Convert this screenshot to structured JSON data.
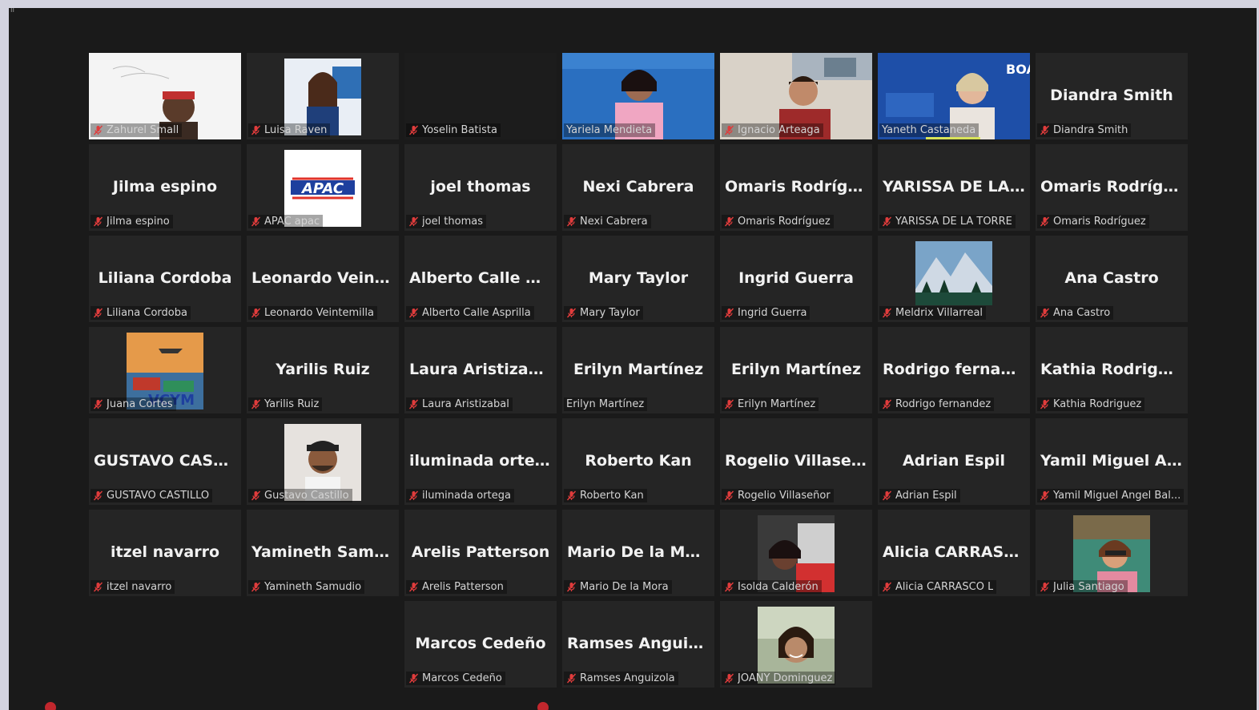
{
  "window": {
    "corner_mark": "ıı"
  },
  "colors": {
    "active_speaker": "#d8e35a",
    "mic_muted": "#e03c3c",
    "tile_bg": "#252525",
    "window_bg": "#1a1a1a"
  },
  "participants": [
    {
      "big": "",
      "label": "Zahurel Small",
      "thumb": "whiteboard",
      "mic": true
    },
    {
      "big": "",
      "label": "Luisa Raven",
      "thumb": "woman-blue",
      "mic": true
    },
    {
      "big": "",
      "label": "Yoselin Batista",
      "thumb": "dark",
      "mic": true
    },
    {
      "big": "",
      "label": "Yariela Mendieta",
      "thumb": "blue-room",
      "mic": false,
      "active": true
    },
    {
      "big": "",
      "label": "Ignacio Arteaga",
      "thumb": "man-red",
      "mic": true
    },
    {
      "big": "",
      "label": "Yaneth Castaneda",
      "thumb": "boa",
      "mic": false,
      "underline": true
    },
    {
      "big": "Diandra Smith",
      "label": "Diandra Smith",
      "mic": true
    },
    {
      "big": "Jilma espino",
      "label": "Jilma espino",
      "mic": true
    },
    {
      "big": "",
      "label": "APAC apac",
      "thumb": "apac",
      "mic": true,
      "logo_text": "APAC"
    },
    {
      "big": "joel thomas",
      "label": "joel thomas",
      "mic": true
    },
    {
      "big": "Nexi Cabrera",
      "label": "Nexi Cabrera",
      "mic": true
    },
    {
      "big": "Omaris Rodríguez",
      "label": "Omaris Rodríguez",
      "mic": true
    },
    {
      "big": "YARISSA DE LA...",
      "label": "YARISSA DE LA TORRE",
      "mic": true
    },
    {
      "big": "Omaris Rodríguez",
      "label": "Omaris Rodríguez",
      "mic": true
    },
    {
      "big": "Liliana Cordoba",
      "label": "Liliana Cordoba",
      "mic": true
    },
    {
      "big": "Leonardo Veint...",
      "label": "Leonardo Veintemilla",
      "mic": true
    },
    {
      "big": "Alberto Calle As...",
      "label": "Alberto Calle Asprilla",
      "mic": true
    },
    {
      "big": "Mary Taylor",
      "label": "Mary Taylor",
      "mic": true
    },
    {
      "big": "Ingrid Guerra",
      "label": "Ingrid Guerra",
      "mic": true
    },
    {
      "big": "",
      "label": "Meldrix Villarreal",
      "thumb": "mountain",
      "mic": true
    },
    {
      "big": "Ana Castro",
      "label": "Ana Castro",
      "mic": true
    },
    {
      "big": "",
      "label": "Juana Cortes",
      "thumb": "cargo",
      "mic": true,
      "logo_text": "VCYM"
    },
    {
      "big": "Yarilis Ruiz",
      "label": "Yarilis Ruiz",
      "mic": true
    },
    {
      "big": "Laura Aristizabal",
      "label": "Laura Aristizabal",
      "mic": true
    },
    {
      "big": "Erilyn Martínez",
      "label": "Erilyn Martínez",
      "mic": false
    },
    {
      "big": "Erilyn Martínez",
      "label": "Erilyn Martínez",
      "mic": true
    },
    {
      "big": "Rodrigo fernan...",
      "label": "Rodrigo fernandez",
      "mic": true
    },
    {
      "big": "Kathia Rodriguez",
      "label": "Kathia Rodriguez",
      "mic": true
    },
    {
      "big": "GUSTAVO CAST...",
      "label": "GUSTAVO CASTILLO",
      "mic": true
    },
    {
      "big": "",
      "label": "Gustavo Castillo",
      "thumb": "man-cap",
      "mic": true
    },
    {
      "big": "iluminada ortega",
      "label": "iluminada ortega",
      "mic": true
    },
    {
      "big": "Roberto Kan",
      "label": "Roberto Kan",
      "mic": true
    },
    {
      "big": "Rogelio Villaseñor",
      "label": "Rogelio Villaseñor",
      "mic": true
    },
    {
      "big": "Adrian Espil",
      "label": "Adrian Espil",
      "mic": true
    },
    {
      "big": "Yamil Miguel A...",
      "label": "Yamil Miguel Angel Bal...",
      "mic": true
    },
    {
      "big": "itzel navarro",
      "label": "itzel navarro",
      "mic": true
    },
    {
      "big": "Yamineth Samu...",
      "label": "Yamineth Samudio",
      "mic": true
    },
    {
      "big": "Arelis Patterson",
      "label": "Arelis Patterson",
      "mic": true
    },
    {
      "big": "Mario De la Mora",
      "label": "Mario De la Mora",
      "mic": true
    },
    {
      "big": "",
      "label": "Isolda Calderón",
      "thumb": "car-selfie",
      "mic": true
    },
    {
      "big": "Alicia CARRASC...",
      "label": "Alicia CARRASCO L",
      "mic": true
    },
    {
      "big": "",
      "label": "Julia Santiago",
      "thumb": "woman-sea",
      "mic": true
    },
    {
      "big": "",
      "label": "",
      "empty": true
    },
    {
      "big": "",
      "label": "",
      "empty": true
    },
    {
      "big": "Marcos Cedeño",
      "label": "Marcos Cedeño",
      "mic": true
    },
    {
      "big": "Ramses Anguiz...",
      "label": "Ramses Anguizola",
      "mic": true
    },
    {
      "big": "",
      "label": "JOANY Dominguez",
      "thumb": "woman-selfie",
      "mic": true
    }
  ]
}
